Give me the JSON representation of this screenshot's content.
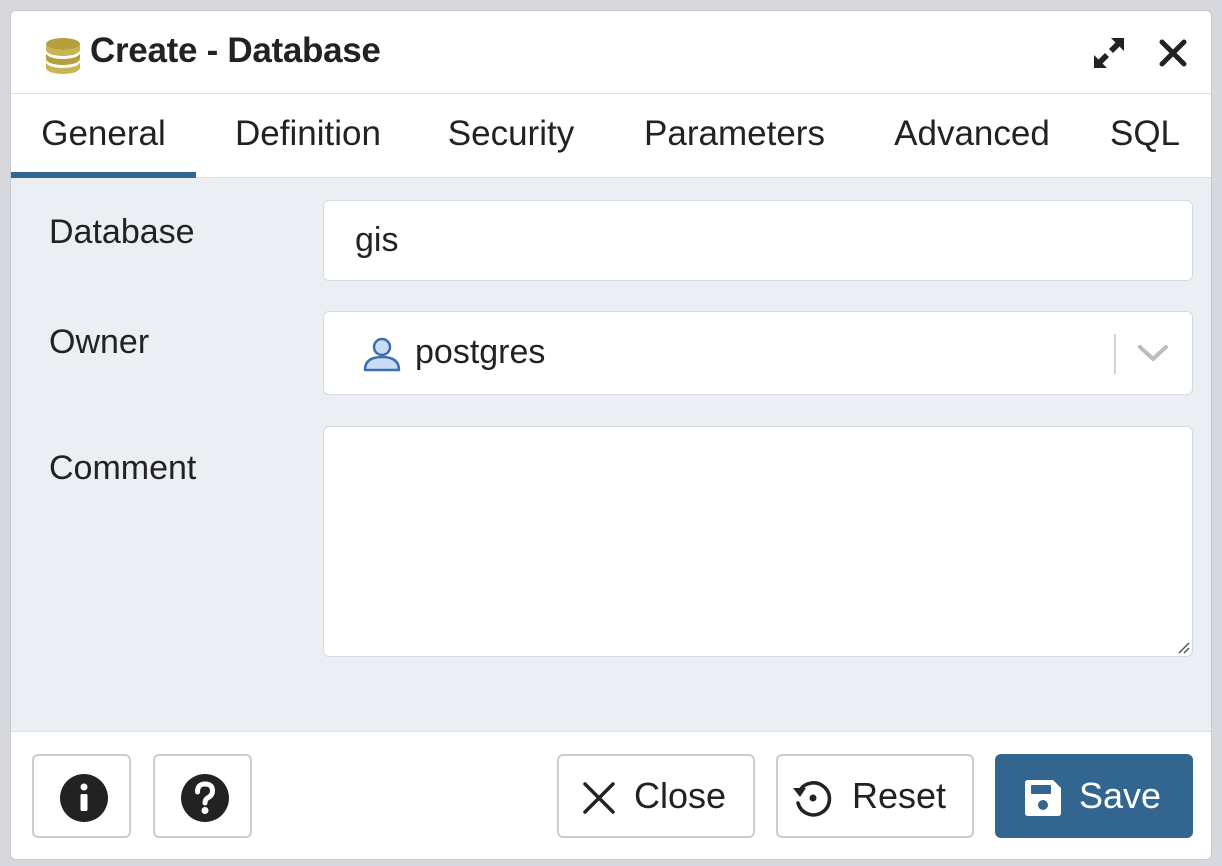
{
  "dialog": {
    "title": "Create - Database",
    "title_icon": "database-icon"
  },
  "tabs": [
    {
      "label": "General",
      "active": true
    },
    {
      "label": "Definition",
      "active": false
    },
    {
      "label": "Security",
      "active": false
    },
    {
      "label": "Parameters",
      "active": false
    },
    {
      "label": "Advanced",
      "active": false
    },
    {
      "label": "SQL",
      "active": false
    }
  ],
  "form": {
    "database": {
      "label": "Database",
      "value": "gis"
    },
    "owner": {
      "label": "Owner",
      "value": "postgres",
      "icon": "user-icon"
    },
    "comment": {
      "label": "Comment",
      "value": ""
    }
  },
  "footer": {
    "info_icon": "info-icon",
    "help_icon": "help-icon",
    "close_label": "Close",
    "reset_label": "Reset",
    "save_label": "Save"
  },
  "colors": {
    "accent": "#326690",
    "content_bg": "#ebeef3",
    "database_icon": "#b5a03d"
  }
}
